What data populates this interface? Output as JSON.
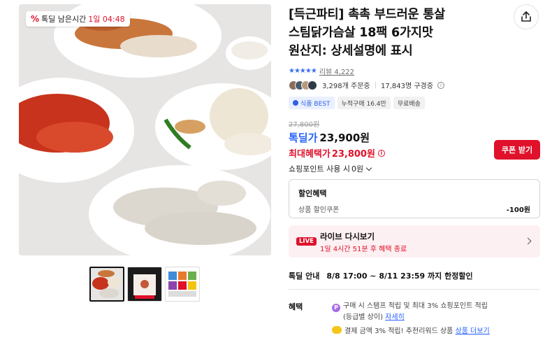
{
  "badge": {
    "label": "톡딜 남은시간",
    "timer": "1일 04:48"
  },
  "product": {
    "title_line1": "[득근파티] 촉촉 부드러운 통살",
    "title_line2": "스팀닭가슴살 18팩 6가지맛",
    "title_line3": "원산지: 상세설명에 표시"
  },
  "rating": {
    "stars": "★★★★★",
    "review_label": "리뷰 4,222"
  },
  "stats": {
    "orders": "3,298개 주문중",
    "subscribers": "17,843명 구경중"
  },
  "tags": [
    "식품 BEST",
    "누적구매 16.4만",
    "무료배송"
  ],
  "price": {
    "original": "27,800원",
    "deal_label": "톡딜가",
    "deal_price": "23,900원",
    "max_benefit_label": "최대혜택가",
    "max_benefit_price": "23,800원",
    "coupon_button": "쿠폰 받기",
    "point_label": "쇼핑포인트 사용 시",
    "point_value": "0원"
  },
  "discount": {
    "title": "할인혜택",
    "row_label": "상품 할인쿠폰",
    "row_value": "-100원"
  },
  "live": {
    "badge": "LIVE",
    "title": "라이브 다시보기",
    "subtitle": "1일 4시간 51분 후 혜택 종료"
  },
  "deal_info": {
    "label": "톡딜 안내",
    "text": "8/8 17:00 ~ 8/11 23:59 까지 한정할인"
  },
  "benefits": {
    "label": "혜택",
    "line1": "구매 시 스탬프 적립 및 최대 3% 쇼핑포인트 적립",
    "line1_sub": "(등급별 상이)",
    "line1_link": "자세히",
    "line2": "결제 금액 3% 적립! 추천리워드 상품",
    "line2_link": "상품 더보기"
  },
  "colors": {
    "accent_red": "#e0112a",
    "accent_blue": "#2762ff"
  },
  "icons": [
    "percent-icon",
    "share-icon",
    "info-icon",
    "chevron-down-icon",
    "chevron-right-icon",
    "point-coin-icon",
    "reward-coin-icon"
  ]
}
